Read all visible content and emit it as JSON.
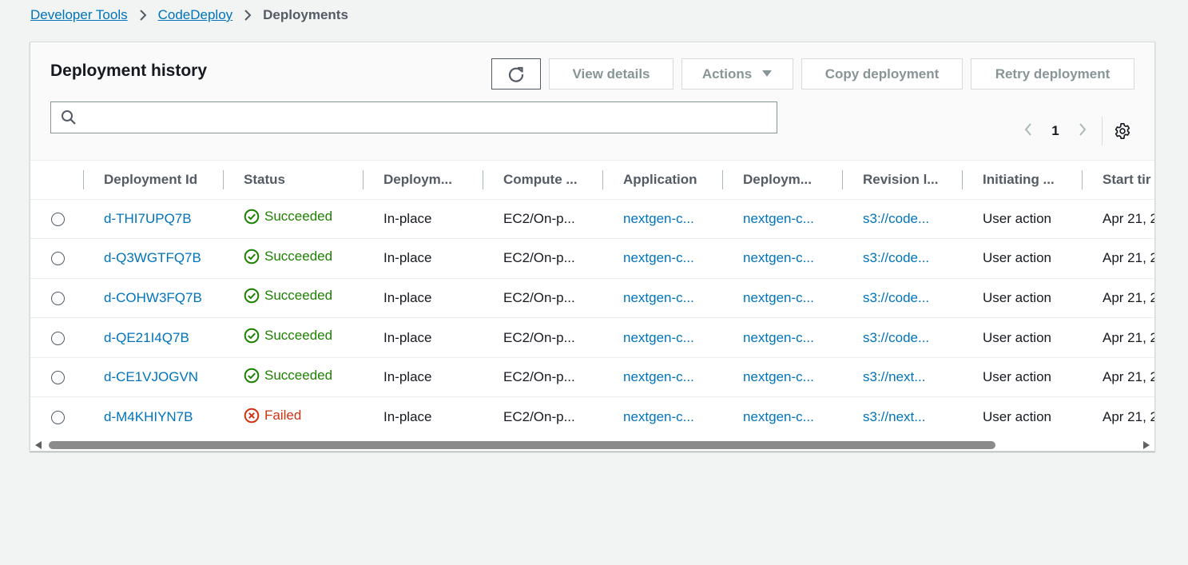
{
  "breadcrumb": {
    "items": [
      "Developer Tools",
      "CodeDeploy"
    ],
    "current": "Deployments"
  },
  "panel": {
    "title": "Deployment history",
    "buttons": {
      "view_details": "View details",
      "actions": "Actions",
      "copy_deployment": "Copy deployment",
      "retry_deployment": "Retry deployment"
    },
    "search": {
      "value": "",
      "placeholder": ""
    },
    "pagination": {
      "current_page": "1"
    }
  },
  "table": {
    "columns": [
      "Deployment Id",
      "Status",
      "Deploym...",
      "Compute ...",
      "Application",
      "Deploym...",
      "Revision l...",
      "Initiating ...",
      "Start tir"
    ],
    "rows": [
      {
        "id": "d-THI7UPQ7B",
        "status": "Succeeded",
        "type": "In-place",
        "compute": "EC2/On-p...",
        "application": "nextgen-c...",
        "group": "nextgen-c...",
        "revision": "s3://code...",
        "initiating": "User action",
        "start": "Apr 21, 2"
      },
      {
        "id": "d-Q3WGTFQ7B",
        "status": "Succeeded",
        "type": "In-place",
        "compute": "EC2/On-p...",
        "application": "nextgen-c...",
        "group": "nextgen-c...",
        "revision": "s3://code...",
        "initiating": "User action",
        "start": "Apr 21, 2"
      },
      {
        "id": "d-COHW3FQ7B",
        "status": "Succeeded",
        "type": "In-place",
        "compute": "EC2/On-p...",
        "application": "nextgen-c...",
        "group": "nextgen-c...",
        "revision": "s3://code...",
        "initiating": "User action",
        "start": "Apr 21, 2"
      },
      {
        "id": "d-QE21I4Q7B",
        "status": "Succeeded",
        "type": "In-place",
        "compute": "EC2/On-p...",
        "application": "nextgen-c...",
        "group": "nextgen-c...",
        "revision": "s3://code...",
        "initiating": "User action",
        "start": "Apr 21, 2"
      },
      {
        "id": "d-CE1VJOGVN",
        "status": "Succeeded",
        "type": "In-place",
        "compute": "EC2/On-p...",
        "application": "nextgen-c...",
        "group": "nextgen-c...",
        "revision": "s3://next...",
        "initiating": "User action",
        "start": "Apr 21, 2"
      },
      {
        "id": "d-M4KHIYN7B",
        "status": "Failed",
        "type": "In-place",
        "compute": "EC2/On-p...",
        "application": "nextgen-c...",
        "group": "nextgen-c...",
        "revision": "s3://next...",
        "initiating": "User action",
        "start": "Apr 21, 2"
      }
    ]
  },
  "icons": {
    "refresh": "refresh-icon",
    "search": "search-icon",
    "settings": "gear-icon",
    "success": "check-circle-icon",
    "failure": "x-circle-icon"
  },
  "colors": {
    "link": "#0073bb",
    "success": "#1d8102",
    "failure": "#d13212",
    "background": "#f2f3f3"
  }
}
